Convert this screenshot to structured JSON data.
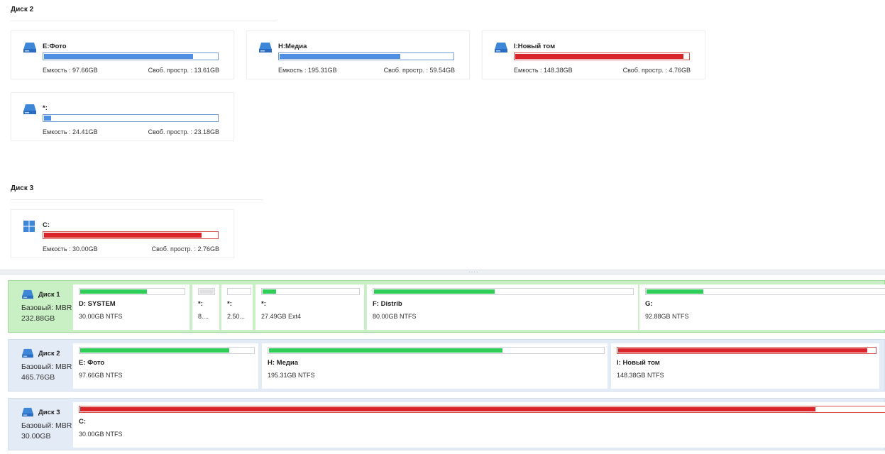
{
  "top": {
    "disk2": {
      "header": "Диск 2",
      "volumes": [
        {
          "name": "E:Фото",
          "capacity": "Емкость : 97.66GB",
          "free": "Своб. простр. : 13.61GB",
          "used_fraction": 0.86,
          "color": "#4f8fe3"
        },
        {
          "name": "H:Медиа",
          "capacity": "Емкость : 195.31GB",
          "free": "Своб. простр. : 59.54GB",
          "used_fraction": 0.7,
          "color": "#4f8fe3"
        },
        {
          "name": "I:Новый том",
          "capacity": "Емкость : 148.38GB",
          "free": "Своб. простр. : 4.76GB",
          "used_fraction": 0.97,
          "color": "#d9252a"
        },
        {
          "name": "*:",
          "capacity": "Емкость : 24.41GB",
          "free": "Своб. простр. : 23.18GB",
          "used_fraction": 0.05,
          "color": "#4f8fe3"
        }
      ]
    },
    "disk3": {
      "header": "Диск 3",
      "volumes": [
        {
          "name": "C:",
          "capacity": "Емкость : 30.00GB",
          "free": "Своб. простр. : 2.76GB",
          "used_fraction": 0.91,
          "color": "#d9252a"
        }
      ]
    }
  },
  "bottom": {
    "rows": [
      {
        "label": "Диск 1",
        "type": "Базовый: MBR",
        "size": "232.88GB",
        "selected": true,
        "partitions": [
          {
            "name": "D: SYSTEM",
            "info": "30.00GB NTFS",
            "used_fraction": 0.65
          },
          {
            "name": "*:",
            "info": "8....",
            "used_fraction": 1.0
          },
          {
            "name": "*:",
            "info": "2.50...",
            "used_fraction": 0.0
          },
          {
            "name": "*:",
            "info": "27.49GB Ext4",
            "used_fraction": 0.15
          },
          {
            "name": "F: Distrib",
            "info": "80.00GB NTFS",
            "used_fraction": 0.47
          },
          {
            "name": "G:",
            "info": "92.88GB NTFS",
            "used_fraction": 0.24
          }
        ]
      },
      {
        "label": "Диск 2",
        "type": "Базовый: MBR",
        "size": "465.76GB",
        "selected": false,
        "partitions": [
          {
            "name": "E: Фото",
            "info": "97.66GB NTFS",
            "used_fraction": 0.86
          },
          {
            "name": "H: Медиа",
            "info": "195.31GB NTFS",
            "used_fraction": 0.7
          },
          {
            "name": "I: Новый том",
            "info": "148.38GB NTFS",
            "used_fraction": 0.97
          }
        ]
      },
      {
        "label": "Диск 3",
        "type": "Базовый: MBR",
        "size": "30.00GB",
        "selected": false,
        "partitions": [
          {
            "name": "C:",
            "info": "30.00GB NTFS",
            "used_fraction": 0.91
          }
        ]
      }
    ]
  },
  "colors": {
    "accent_blue": "#4f8fe3",
    "used_green": "#2fce57",
    "full_red": "#d9252a",
    "selected_row": "#c8f0c4"
  }
}
